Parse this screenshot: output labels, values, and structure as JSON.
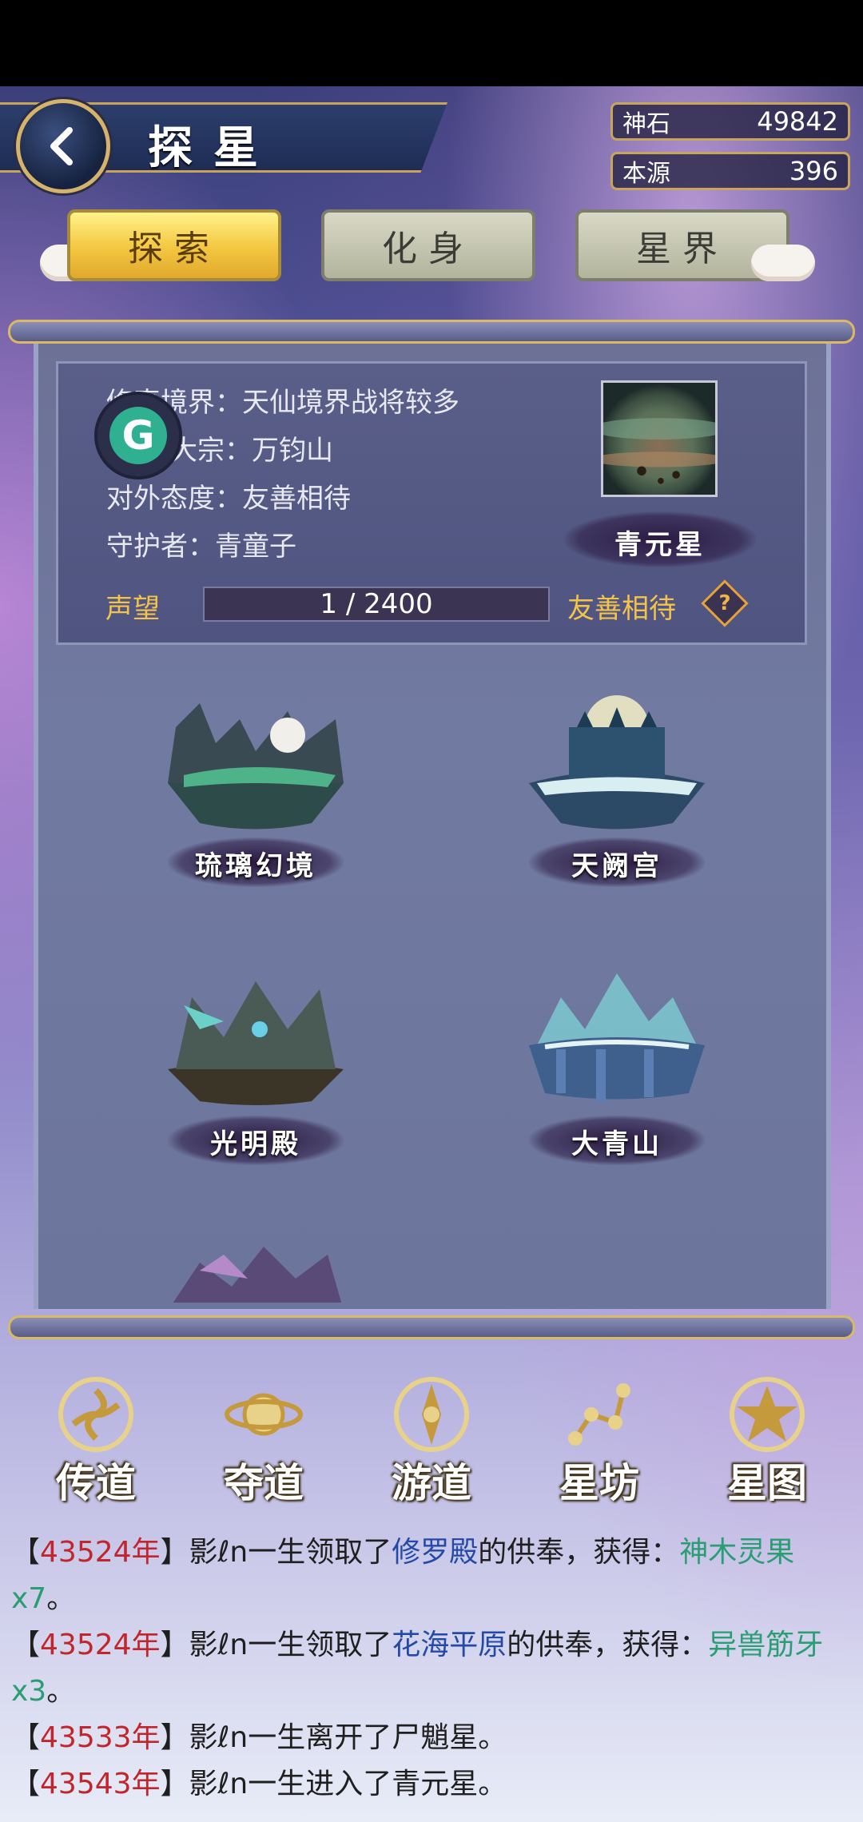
{
  "header": {
    "title": "探星",
    "currencies": [
      {
        "label": "神石",
        "value": "49842"
      },
      {
        "label": "本源",
        "value": "396"
      }
    ]
  },
  "tabs": [
    {
      "label": "探索",
      "active": true
    },
    {
      "label": "化身",
      "active": false
    },
    {
      "label": "星界",
      "active": false
    }
  ],
  "info": {
    "realm": "修真境界：天仙境界战将较多",
    "sect": "大宗：万钧山",
    "attitude": "对外态度：友善相待",
    "guardian": "守护者：青童子",
    "planet_name": "青元星",
    "reputation_label": "声望",
    "reputation_value": "1 / 2400",
    "reputation_status": "友善相待",
    "help_symbol": "?",
    "badge_letter": "G"
  },
  "locations": [
    {
      "name": "琉璃幻境"
    },
    {
      "name": "天阙宫"
    },
    {
      "name": "光明殿"
    },
    {
      "name": "大青山"
    }
  ],
  "nav": [
    {
      "label": "传道",
      "icon": "triskelion-icon"
    },
    {
      "label": "夺道",
      "icon": "orbit-icon"
    },
    {
      "label": "游道",
      "icon": "compass-icon"
    },
    {
      "label": "星坊",
      "icon": "constellation-icon"
    },
    {
      "label": "星图",
      "icon": "star-map-icon"
    }
  ],
  "log": [
    {
      "pre": "【",
      "year": "43524年",
      "mid": "】影ℓn一生领取了",
      "place": "修罗殿",
      "mid2": "的供奉，获得：",
      "item": "神木灵果x7",
      "end": "。"
    },
    {
      "pre": "【",
      "year": "43524年",
      "mid": "】影ℓn一生领取了",
      "place": "花海平原",
      "mid2": "的供奉，获得：",
      "item": "异兽筋牙x3",
      "end": "。"
    },
    {
      "pre": "【",
      "year": "43533年",
      "mid": "】影ℓn一生离开了尸魈星。",
      "place": "",
      "mid2": "",
      "item": "",
      "end": ""
    },
    {
      "pre": "【",
      "year": "43543年",
      "mid": "】影ℓn一生进入了青元星。",
      "place": "",
      "mid2": "",
      "item": "",
      "end": ""
    }
  ],
  "colors": {
    "accent_gold": "#f4c44a",
    "log_year": "#c0262b",
    "log_place": "#2449a6",
    "log_item": "#2a9d73"
  }
}
